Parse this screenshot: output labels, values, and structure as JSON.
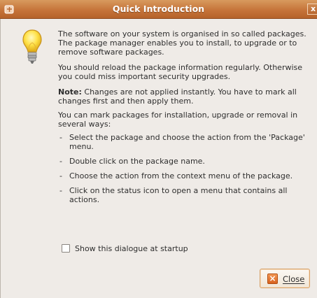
{
  "window": {
    "title": "Quick Introduction",
    "close_glyph": "x"
  },
  "message": {
    "paragraph_1": "The software on your system is organised in so called packages. The package manager enables you to install, to upgrade or to remove software packages.",
    "paragraph_2": "You should reload the package information regularly. Otherwise you could miss important security upgrades.",
    "note_label": "Note:",
    "note_text": " Changes are not applied instantly. You have to mark all changes first and then apply them.",
    "ways_intro": "You can mark packages for installation, upgrade or removal in several ways:",
    "ways": [
      "Select the package and choose the action from the 'Package' menu.",
      "Double click on the package name.",
      "Choose the action from the context menu of the package.",
      "Click on the status icon to open a menu that contains all actions."
    ]
  },
  "checkbox": {
    "label": "Show this dialogue at startup",
    "checked": false
  },
  "close_button": {
    "label": "Close",
    "icon": "close-icon"
  },
  "icons": {
    "titlebar": "window-menu-icon",
    "dialog": "lightbulb-icon"
  },
  "colors": {
    "titlebar": "#c6743a",
    "dialog_background": "#efebe7",
    "button_border": "#d7a066",
    "close_icon": "#e47a35"
  }
}
